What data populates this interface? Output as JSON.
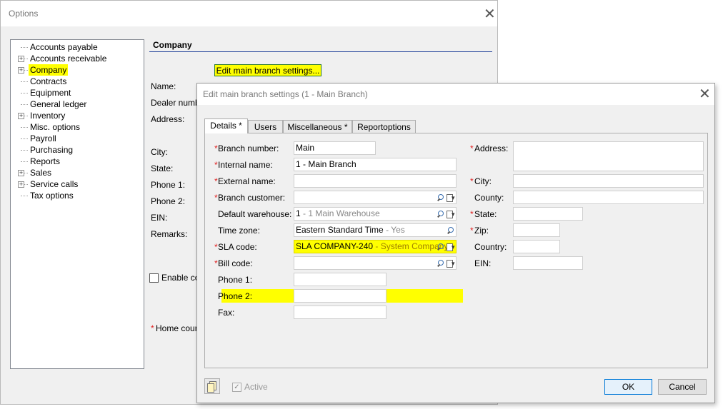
{
  "options_window": {
    "title": "Options",
    "close_glyph": "✕",
    "tree": [
      {
        "label": "Accounts payable",
        "expandable": false,
        "highlighted": false
      },
      {
        "label": "Accounts receivable",
        "expandable": true,
        "highlighted": false
      },
      {
        "label": "Company",
        "expandable": true,
        "highlighted": true
      },
      {
        "label": "Contracts",
        "expandable": false,
        "highlighted": false
      },
      {
        "label": "Equipment",
        "expandable": false,
        "highlighted": false
      },
      {
        "label": "General ledger",
        "expandable": false,
        "highlighted": false
      },
      {
        "label": "Inventory",
        "expandable": true,
        "highlighted": false
      },
      {
        "label": "Misc. options",
        "expandable": false,
        "highlighted": false
      },
      {
        "label": "Payroll",
        "expandable": false,
        "highlighted": false
      },
      {
        "label": "Purchasing",
        "expandable": false,
        "highlighted": false
      },
      {
        "label": "Reports",
        "expandable": false,
        "highlighted": false
      },
      {
        "label": "Sales",
        "expandable": true,
        "highlighted": false
      },
      {
        "label": "Service calls",
        "expandable": true,
        "highlighted": false
      },
      {
        "label": "Tax options",
        "expandable": false,
        "highlighted": false
      }
    ],
    "section_title": "Company",
    "edit_main_branch_button": "Edit main branch settings...",
    "labels": {
      "name": "Name:",
      "dealer_number": "Dealer number",
      "address": "Address:",
      "city": "City:",
      "state": "State:",
      "phone1": "Phone 1:",
      "phone2": "Phone 2:",
      "ein": "EIN:",
      "remarks": "Remarks:",
      "enable": "Enable co",
      "home_country_req": "*",
      "home_country": "Home countr"
    }
  },
  "edit_dialog": {
    "title": "Edit main branch settings (1 - Main Branch)",
    "close_glyph": "✕",
    "tabs": [
      "Details *",
      "Users",
      "Miscellaneous *",
      "Reportoptions"
    ],
    "left_fields": {
      "branch_number": {
        "req": "*",
        "label": "Branch number:",
        "value": "Main"
      },
      "internal_name": {
        "req": "*",
        "label": "Internal name:",
        "value": "1 - Main Branch"
      },
      "external_name": {
        "req": "*",
        "label": "External name:",
        "value": ""
      },
      "branch_customer": {
        "req": "*",
        "label": "Branch customer:",
        "value": ""
      },
      "default_warehouse": {
        "label": "Default warehouse:",
        "value": "1",
        "value_suffix": " - 1 Main Warehouse"
      },
      "time_zone": {
        "label": "Time zone:",
        "value": "Eastern Standard Time",
        "value_suffix": " - Yes"
      },
      "sla_code": {
        "req": "*",
        "label": "SLA code:",
        "value": "SLA COMPANY-240",
        "value_suffix": " - System Company"
      },
      "bill_code": {
        "req": "*",
        "label": "Bill code:",
        "value": ""
      },
      "phone1": {
        "label": "Phone 1:",
        "value": ""
      },
      "phone2": {
        "label": "Phone 2:",
        "value": ""
      },
      "fax": {
        "label": "Fax:",
        "value": ""
      }
    },
    "right_fields": {
      "address": {
        "req": "*",
        "label": "Address:",
        "value": ""
      },
      "city": {
        "req": "*",
        "label": "City:",
        "value": ""
      },
      "county": {
        "label": "County:",
        "value": ""
      },
      "state": {
        "req": "*",
        "label": "State:",
        "value": ""
      },
      "zip": {
        "req": "*",
        "label": "Zip:",
        "value": ""
      },
      "country": {
        "label": "Country:",
        "value": ""
      },
      "ein": {
        "label": "EIN:",
        "value": ""
      }
    },
    "active_label": "Active",
    "ok_label": "OK",
    "cancel_label": "Cancel"
  }
}
